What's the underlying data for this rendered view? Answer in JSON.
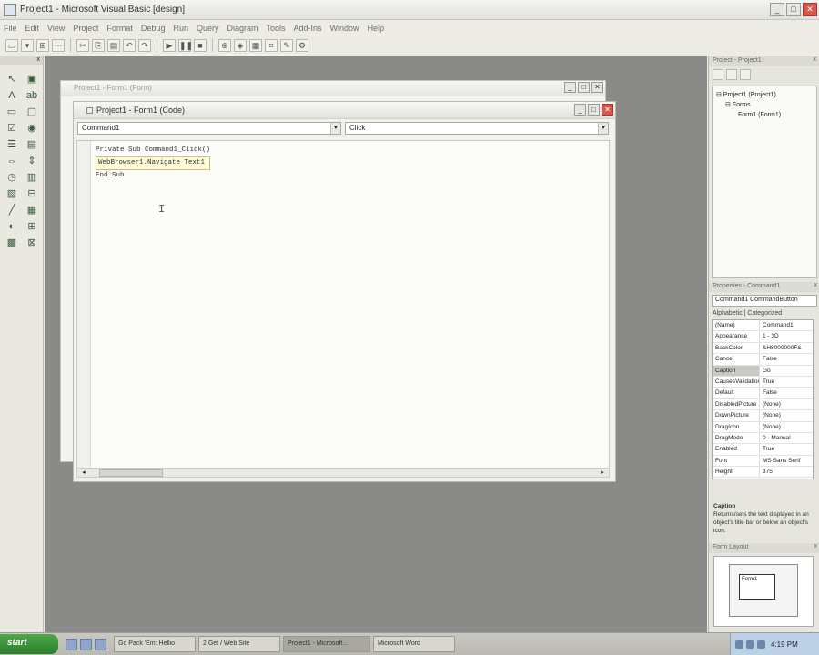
{
  "app": {
    "title": "Project1 - Microsoft Visual Basic [design]",
    "window_buttons": [
      "_",
      "□",
      "✕"
    ]
  },
  "menubar": {
    "items": [
      "File",
      "Edit",
      "View",
      "Project",
      "Format",
      "Debug",
      "Run",
      "Query",
      "Diagram",
      "Tools",
      "Add-Ins",
      "Window",
      "Help"
    ]
  },
  "toolbar": {
    "buttons": [
      "▭",
      "▾",
      "⊞",
      "⋯",
      "✂",
      "⎘",
      "▤",
      "↶",
      "↷",
      "▶",
      "❚❚",
      "■",
      "⊕",
      "◈",
      "▦",
      "⌗",
      "✎",
      "⚙"
    ]
  },
  "toolbox": {
    "header": "x",
    "tools": [
      "↖",
      "▣",
      "A",
      "ab",
      "▭",
      "▢",
      "☑",
      "◉",
      "☰",
      "▤",
      "⇔",
      "⇕",
      "◷",
      "▥",
      "▧",
      "⊟",
      "╱",
      "▦",
      "◐",
      "⊞",
      "▩",
      "⊠"
    ]
  },
  "form_window": {
    "title": "Project1 - Form1 (Form)"
  },
  "code_window": {
    "title": "Project1 - Form1 (Code)",
    "object_combo": "Command1",
    "proc_combo": "Click",
    "lines": [
      "Private Sub Command1_Click()",
      "WebBrowser1.Navigate Text1",
      "End Sub"
    ],
    "highlight_text": "WebBrowser1.Navigate Text1"
  },
  "project_panel": {
    "title": "Project - Project1",
    "close": "x",
    "tree": [
      "⊟ Project1 (Project1)",
      "⊟ Forms",
      "Form1 (Form1)"
    ]
  },
  "properties_panel": {
    "title": "Properties - Command1",
    "close": "x",
    "object": "Command1 CommandButton",
    "tabs": "Alphabetic | Categorized",
    "rows": [
      {
        "k": "(Name)",
        "v": "Command1"
      },
      {
        "k": "Appearance",
        "v": "1 - 3D"
      },
      {
        "k": "BackColor",
        "v": "&H8000000F&"
      },
      {
        "k": "Cancel",
        "v": "False"
      },
      {
        "k": "Caption",
        "v": "Go"
      },
      {
        "k": "CausesValidation",
        "v": "True"
      },
      {
        "k": "Default",
        "v": "False"
      },
      {
        "k": "DisabledPicture",
        "v": "(None)"
      },
      {
        "k": "DownPicture",
        "v": "(None)"
      },
      {
        "k": "DragIcon",
        "v": "(None)"
      },
      {
        "k": "DragMode",
        "v": "0 - Manual"
      },
      {
        "k": "Enabled",
        "v": "True"
      },
      {
        "k": "Font",
        "v": "MS Sans Serif"
      },
      {
        "k": "Height",
        "v": "375"
      }
    ],
    "desc_title": "Caption",
    "desc_text": "Returns/sets the text displayed in an object's title bar or below an object's icon."
  },
  "layout_panel": {
    "title": "Form Layout",
    "form_label": "Form1"
  },
  "taskbar": {
    "start": "start",
    "tasks": [
      "Go Pack 'Em: Hellio",
      "2 Get / Web Site",
      "Project1 - Microsoft...",
      "Microsoft Word"
    ],
    "clock": "4:19 PM"
  }
}
